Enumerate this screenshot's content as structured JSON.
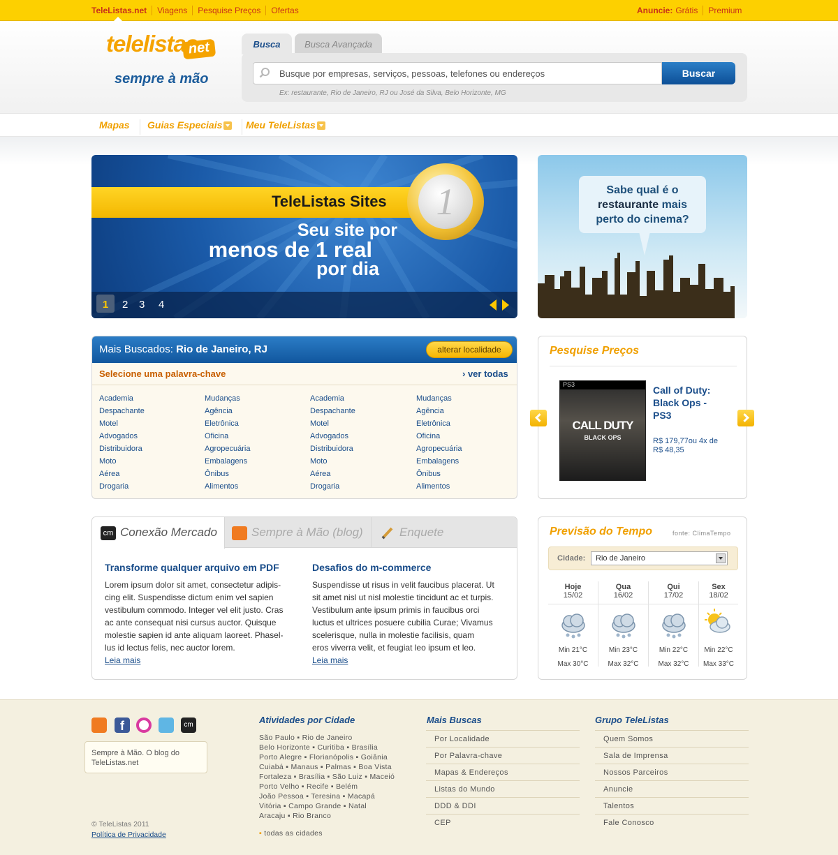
{
  "topbar": {
    "nav": [
      "TeleListas.net",
      "Viagens",
      "Pesquise Preços",
      "Ofertas"
    ],
    "anuncie_label": "Anuncie:",
    "gratis": "Grátis",
    "premium": "Premium"
  },
  "header": {
    "logo_main": "telelistas",
    "logo_net": "net",
    "logo_tagline": "sempre à mão",
    "tabs": [
      "Busca",
      "Busca Avançada"
    ],
    "search_placeholder": "Busque por empresas, serviços, pessoas, telefones ou endereços",
    "search_button": "Buscar",
    "search_hint": "Ex: restaurante, Rio de Janeiro, RJ ou José da Silva, Belo Horizonte, MG"
  },
  "menu": [
    "Mapas",
    "Guias Especiais",
    "Meu TeleListas"
  ],
  "banner": {
    "title": "TeleListas Sites",
    "line1": "Seu site por",
    "line2": "menos de 1 real",
    "line3": "por dia",
    "coin": "1",
    "pages": [
      "1",
      "2",
      "3",
      "4"
    ]
  },
  "ad": {
    "line1": "Sabe qual é o",
    "bold": "restaurante",
    "line2": "mais",
    "line3": "perto do cinema?"
  },
  "mais_buscados": {
    "prefix": "Mais Buscados:",
    "location": "Rio de Janeiro, RJ",
    "alter_button": "alterar localidade",
    "select_label": "Selecione uma palavra-chave",
    "ver_todas": "ver todas",
    "columns": [
      [
        "Academia",
        "Despachante",
        "Motel",
        "Advogados",
        "Distribuidora",
        "Moto",
        "Aérea",
        "Drogaria"
      ],
      [
        "Mudanças",
        "Agência",
        "Eletrônica",
        "Oficina",
        "Agropecuária",
        "Embalagens",
        "Ônibus",
        "Alimentos"
      ],
      [
        "Academia",
        "Despachante",
        "Motel",
        "Advogados",
        "Distribuidora",
        "Moto",
        "Aérea",
        "Drogaria"
      ],
      [
        "Mudanças",
        "Agência",
        "Eletrônica",
        "Oficina",
        "Agropecuária",
        "Embalagens",
        "Ônibus",
        "Alimentos"
      ]
    ]
  },
  "precos": {
    "title": "Pesquise Preços",
    "product_line1": "Call of Duty:",
    "product_line2": "Black Ops -",
    "product_line3": "PS3",
    "price_line1": "R$ 179,77ou 4x de",
    "price_line2": "R$ 48,35",
    "box_ps3": "PS3",
    "box_title": "CALL DUTY",
    "box_sub": "BLACK OPS"
  },
  "conexao": {
    "tabs": [
      "Conexão Mercado",
      "Sempre à Mão (blog)",
      "Enquete"
    ],
    "articles": [
      {
        "title": "Transforme qualquer arquivo em PDF",
        "lines": [
          "Lorem ipsum dolor sit amet, consectetur adipis-",
          "cing elit. Suspendisse dictum enim vel sapien",
          "vestibulum commodo. Integer vel elit justo. Cras",
          "ac ante consequat nisi cursus auctor. Quisque",
          "molestie sapien id ante aliquam laoreet. Phasel-",
          "lus id lectus felis, nec auctor lorem."
        ],
        "more": "Leia mais"
      },
      {
        "title": "Desafios do m-commerce",
        "lines": [
          "Suspendisse ut risus in velit faucibus placerat. Ut",
          "sit amet nisl ut nisl molestie tincidunt ac et turpis.",
          "Vestibulum ante ipsum primis in faucibus orci",
          "luctus et ultrices posuere cubilia Curae; Vivamus",
          "scelerisque, nulla in molestie facilisis, quam",
          "eros viverra velit, et feugiat leo ipsum et leo."
        ],
        "more": "Leia mais"
      }
    ]
  },
  "tempo": {
    "title": "Previsão do Tempo",
    "fonte": "fonte: ClimaTempo",
    "city_label": "Cidade:",
    "city": "Rio de Janeiro",
    "days": [
      {
        "name": "Hoje",
        "date": "15/02",
        "min": "Min 21°C",
        "max": "Max 30°C",
        "icon": "snow-cloud-icon"
      },
      {
        "name": "Qua",
        "date": "16/02",
        "min": "Min 23°C",
        "max": "Max 32°C",
        "icon": "snow-cloud-icon"
      },
      {
        "name": "Qui",
        "date": "17/02",
        "min": "Min 22°C",
        "max": "Max 32°C",
        "icon": "snow-cloud-icon"
      },
      {
        "name": "Sex",
        "date": "18/02",
        "min": "Min 22°C",
        "max": "Max 33°C",
        "icon": "sun-cloud-icon"
      }
    ]
  },
  "footer": {
    "tip": "Sempre à Mão. O blog do TeleListas.net",
    "copyright": "© TeleListas 2011",
    "privacy": "Política de Privacidade",
    "atividades_title": "Atividades por Cidade",
    "cities": [
      "São Paulo ▪ Rio de Janeiro",
      "Belo Horizonte ▪ Curitiba ▪ Brasília",
      "Porto Alegre ▪ Florianópolis ▪ Goiânia",
      "Cuiabá ▪ Manaus ▪ Palmas ▪ Boa Vista",
      "Fortaleza ▪ Brasília ▪ São Luiz ▪ Maceió",
      "Porto Velho ▪ Recife ▪ Belém",
      "João Pessoa ▪ Teresina ▪ Macapá",
      "Vitória ▪ Campo Grande ▪ Natal",
      "Aracaju ▪ Rio Branco"
    ],
    "todas_cidades": "todas as cidades",
    "mais_title": "Mais Buscas",
    "mais": [
      "Por Localidade",
      "Por Palavra-chave",
      "Mapas & Endereços",
      "Listas do Mundo",
      "DDD & DDI",
      "CEP"
    ],
    "grupo_title": "Grupo TeleListas",
    "grupo": [
      "Quem Somos",
      "Sala de Imprensa",
      "Nossos Parceiros",
      "Anuncie",
      "Talentos",
      "Fale Conosco"
    ]
  },
  "colors": {
    "yellow": "#fdd000",
    "orange": "#f0a000",
    "blue": "#1a4d8a",
    "footer_bg": "#f4f0e0"
  }
}
